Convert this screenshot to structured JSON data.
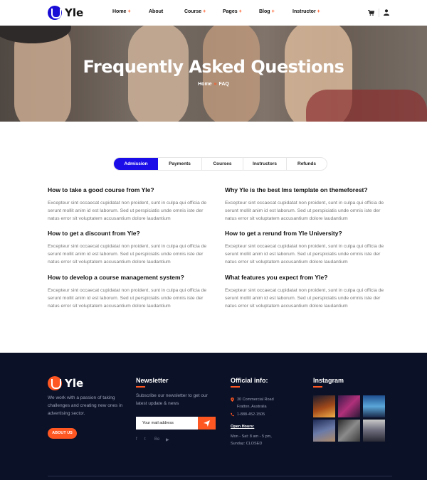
{
  "header": {
    "logo_text": "Yle",
    "nav": [
      {
        "label": "Home",
        "plus": "+"
      },
      {
        "label": "About",
        "plus": ""
      },
      {
        "label": "Course",
        "plus": "+"
      },
      {
        "label": "Pages",
        "plus": "+"
      },
      {
        "label": "Blog",
        "plus": "+"
      },
      {
        "label": "Instructor",
        "plus": "+"
      }
    ],
    "icons": [
      "cart-icon",
      "user-icon"
    ]
  },
  "hero": {
    "title": "Frequently Asked Questions",
    "breadcrumb": {
      "home": "Home",
      "separator": "»",
      "current": "FAQ"
    }
  },
  "tabs": [
    {
      "label": "Admission",
      "active": true
    },
    {
      "label": "Payments",
      "active": false
    },
    {
      "label": "Courses",
      "active": false
    },
    {
      "label": "Instructors",
      "active": false
    },
    {
      "label": "Refunds",
      "active": false
    }
  ],
  "faqs": [
    {
      "question": "How to take a good course from Yle?",
      "answer": "Excepteur sint occaecat cupidatat non proident, sunt in culpa qui officia de serunt mollit anim id est laborum. Sed ut perspiciatis unde omnis iste der natus error sit voluptatem accusantium dolore laudantium"
    },
    {
      "question": "Why Yle is the best lms template on themeforest?",
      "answer": "Excepteur sint occaecat cupidatat non proident, sunt in culpa qui officia de serunt mollit anim id est laborum. Sed ut perspiciatis unde omnis iste der natus error sit voluptatem accusantium dolore laudantium"
    },
    {
      "question": "How to get a discount from Yle?",
      "answer": "Excepteur sint occaecat cupidatat non proident, sunt in culpa qui officia de serunt mollit anim id est laborum. Sed ut perspiciatis unde omnis iste der natus error sit voluptatem accusantium dolore laudantium"
    },
    {
      "question": "How to get a rerund from Yle University?",
      "answer": "Excepteur sint occaecat cupidatat non proident, sunt in culpa qui officia de serunt mollit anim id est laborum. Sed ut perspiciatis unde omnis iste der natus error sit voluptatem accusantium dolore laudantium"
    },
    {
      "question": "How to develop a course management system?",
      "answer": "Excepteur sint occaecat cupidatat non proident, sunt in culpa qui officia de serunt mollit anim id est laborum. Sed ut perspiciatis unde omnis iste der natus error sit voluptatem accusantium dolore laudantium"
    },
    {
      "question": "What features you expect from Yle?",
      "answer": "Excepteur sint occaecat cupidatat non proident, sunt in culpa qui officia de serunt mollit anim id est laborum. Sed ut perspiciatis unde omnis iste der natus error sit voluptatem accusantium dolore laudantium"
    }
  ],
  "footer": {
    "logo_text": "Yle",
    "description": "We work with a passion of taking challenges and creating new ones in advertising sector.",
    "about_button": "ABOUT US",
    "newsletter": {
      "heading": "Newsletter",
      "text": "Subscribe our newsletter to get our latest update & news",
      "placeholder": "Your mail address",
      "send_icon": "paper-plane-icon"
    },
    "social": [
      "f",
      "t",
      "Be",
      "▶"
    ],
    "info": {
      "heading": "Official info:",
      "address_line1": "30 Commercial Road",
      "address_line2": "Fratton, Australia",
      "phone": "1-888-452-1505",
      "open_hours_label": "Open Hours:",
      "hours_line1": "Mon - Sat: 8 am - 5 pm,",
      "hours_line2": "Sunday: CLOSED"
    },
    "instagram": {
      "heading": "Instagram"
    }
  },
  "colors": {
    "accent": "#ff5722",
    "primary": "#1a0de8",
    "footer_bg": "#0b1127"
  }
}
